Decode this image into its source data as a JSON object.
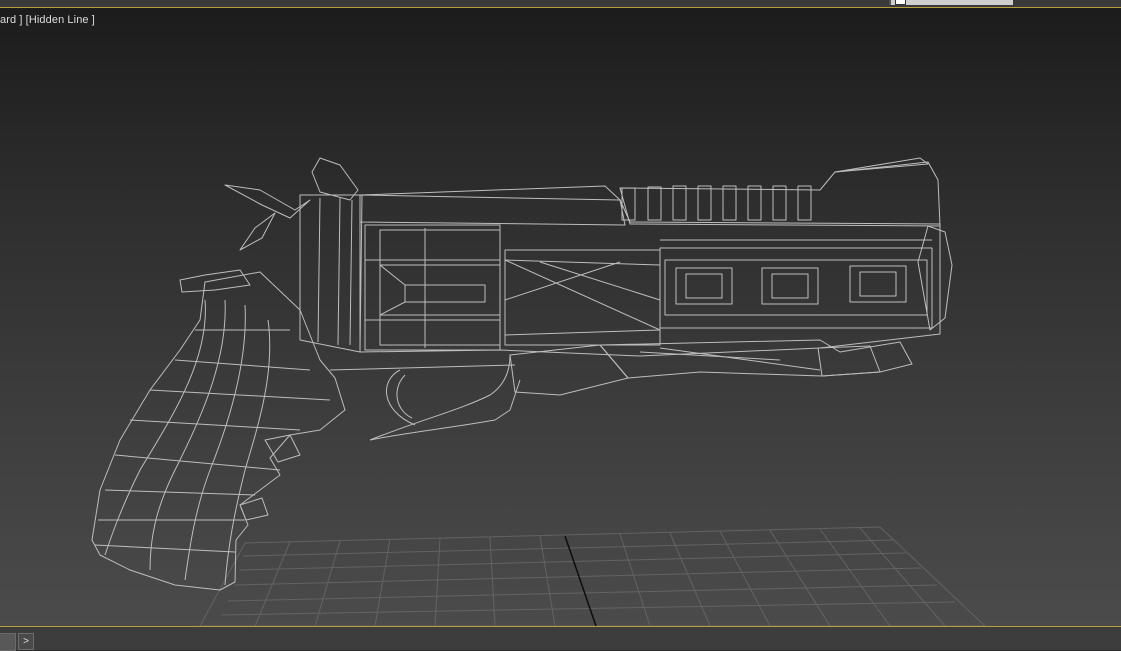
{
  "viewport": {
    "label": "ard ] [Hidden Line ]",
    "shading_mode": "Hidden Line",
    "model": "revolver"
  },
  "timeline": {
    "next_label": ">"
  },
  "colors": {
    "accent_border": "#b8a13c",
    "wire": "#bdbdbd",
    "viewport_top": "#1c1c1c",
    "viewport_bottom": "#4b4b4b"
  }
}
